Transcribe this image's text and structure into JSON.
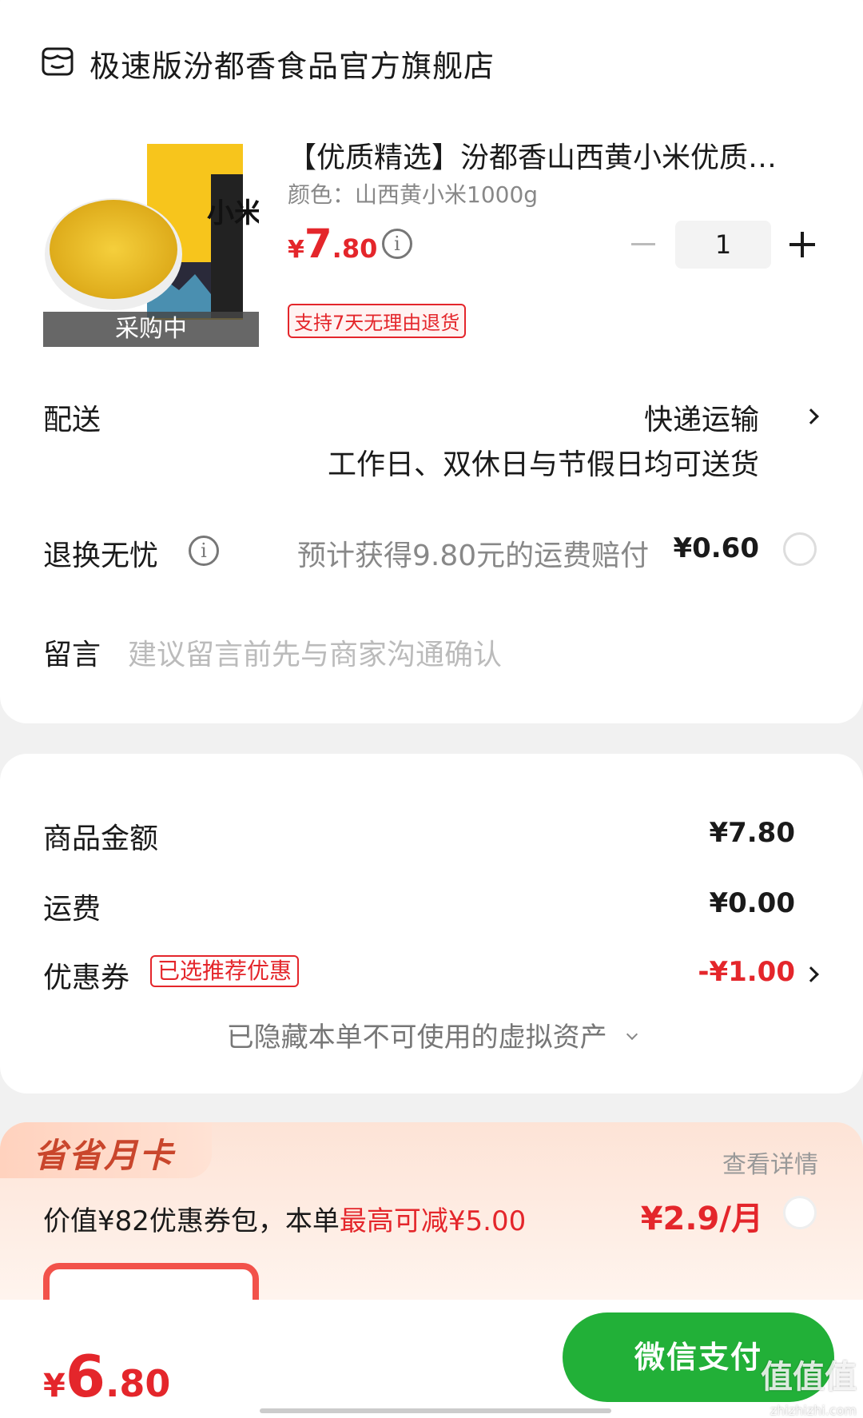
{
  "shop": {
    "name": "极速版汾都香食品官方旗舰店",
    "icon": "shop-icon"
  },
  "product": {
    "title": "【优质精选】汾都香山西黄小米优质…",
    "spec": "颜色：山西黄小米1000g",
    "price_yen": "¥",
    "price_int": "7",
    "price_dec": ".80",
    "status": "采购中",
    "quantity": "1",
    "return_badge": "支持7天无理由退货",
    "package_text": "小米"
  },
  "delivery": {
    "label": "配送",
    "method": "快递运输",
    "schedule": "工作日、双休日与节假日均可送货"
  },
  "return_insurance": {
    "label": "退换无忧",
    "desc": "预计获得9.80元的运费赔付",
    "price": "¥0.60"
  },
  "message": {
    "label": "留言",
    "placeholder": "建议留言前先与商家沟通确认"
  },
  "summary": {
    "goods_label": "商品金额",
    "goods_value": "¥7.80",
    "shipping_label": "运费",
    "shipping_value": "¥0.00",
    "coupon_label": "优惠券",
    "coupon_badge": "已选推荐优惠",
    "coupon_value": "-¥1.00",
    "hidden_assets": "已隐藏本单不可使用的虚拟资产"
  },
  "month_card": {
    "title": "省省月卡",
    "detail_link": "查看详情",
    "desc_prefix": "价值¥82优惠券包，本单",
    "desc_highlight": "最高可减¥5.00",
    "price": "¥2.9/月"
  },
  "footer": {
    "total_yen": "¥",
    "total_int": "6",
    "total_dec": ".80",
    "pay_button": "微信支付",
    "watermark": "值值值",
    "watermark_sub": "zhizhizhi.com"
  },
  "colors": {
    "accent_red": "#e4262b",
    "pay_green": "#22b038",
    "month_card_bg": "#fde3d6"
  }
}
